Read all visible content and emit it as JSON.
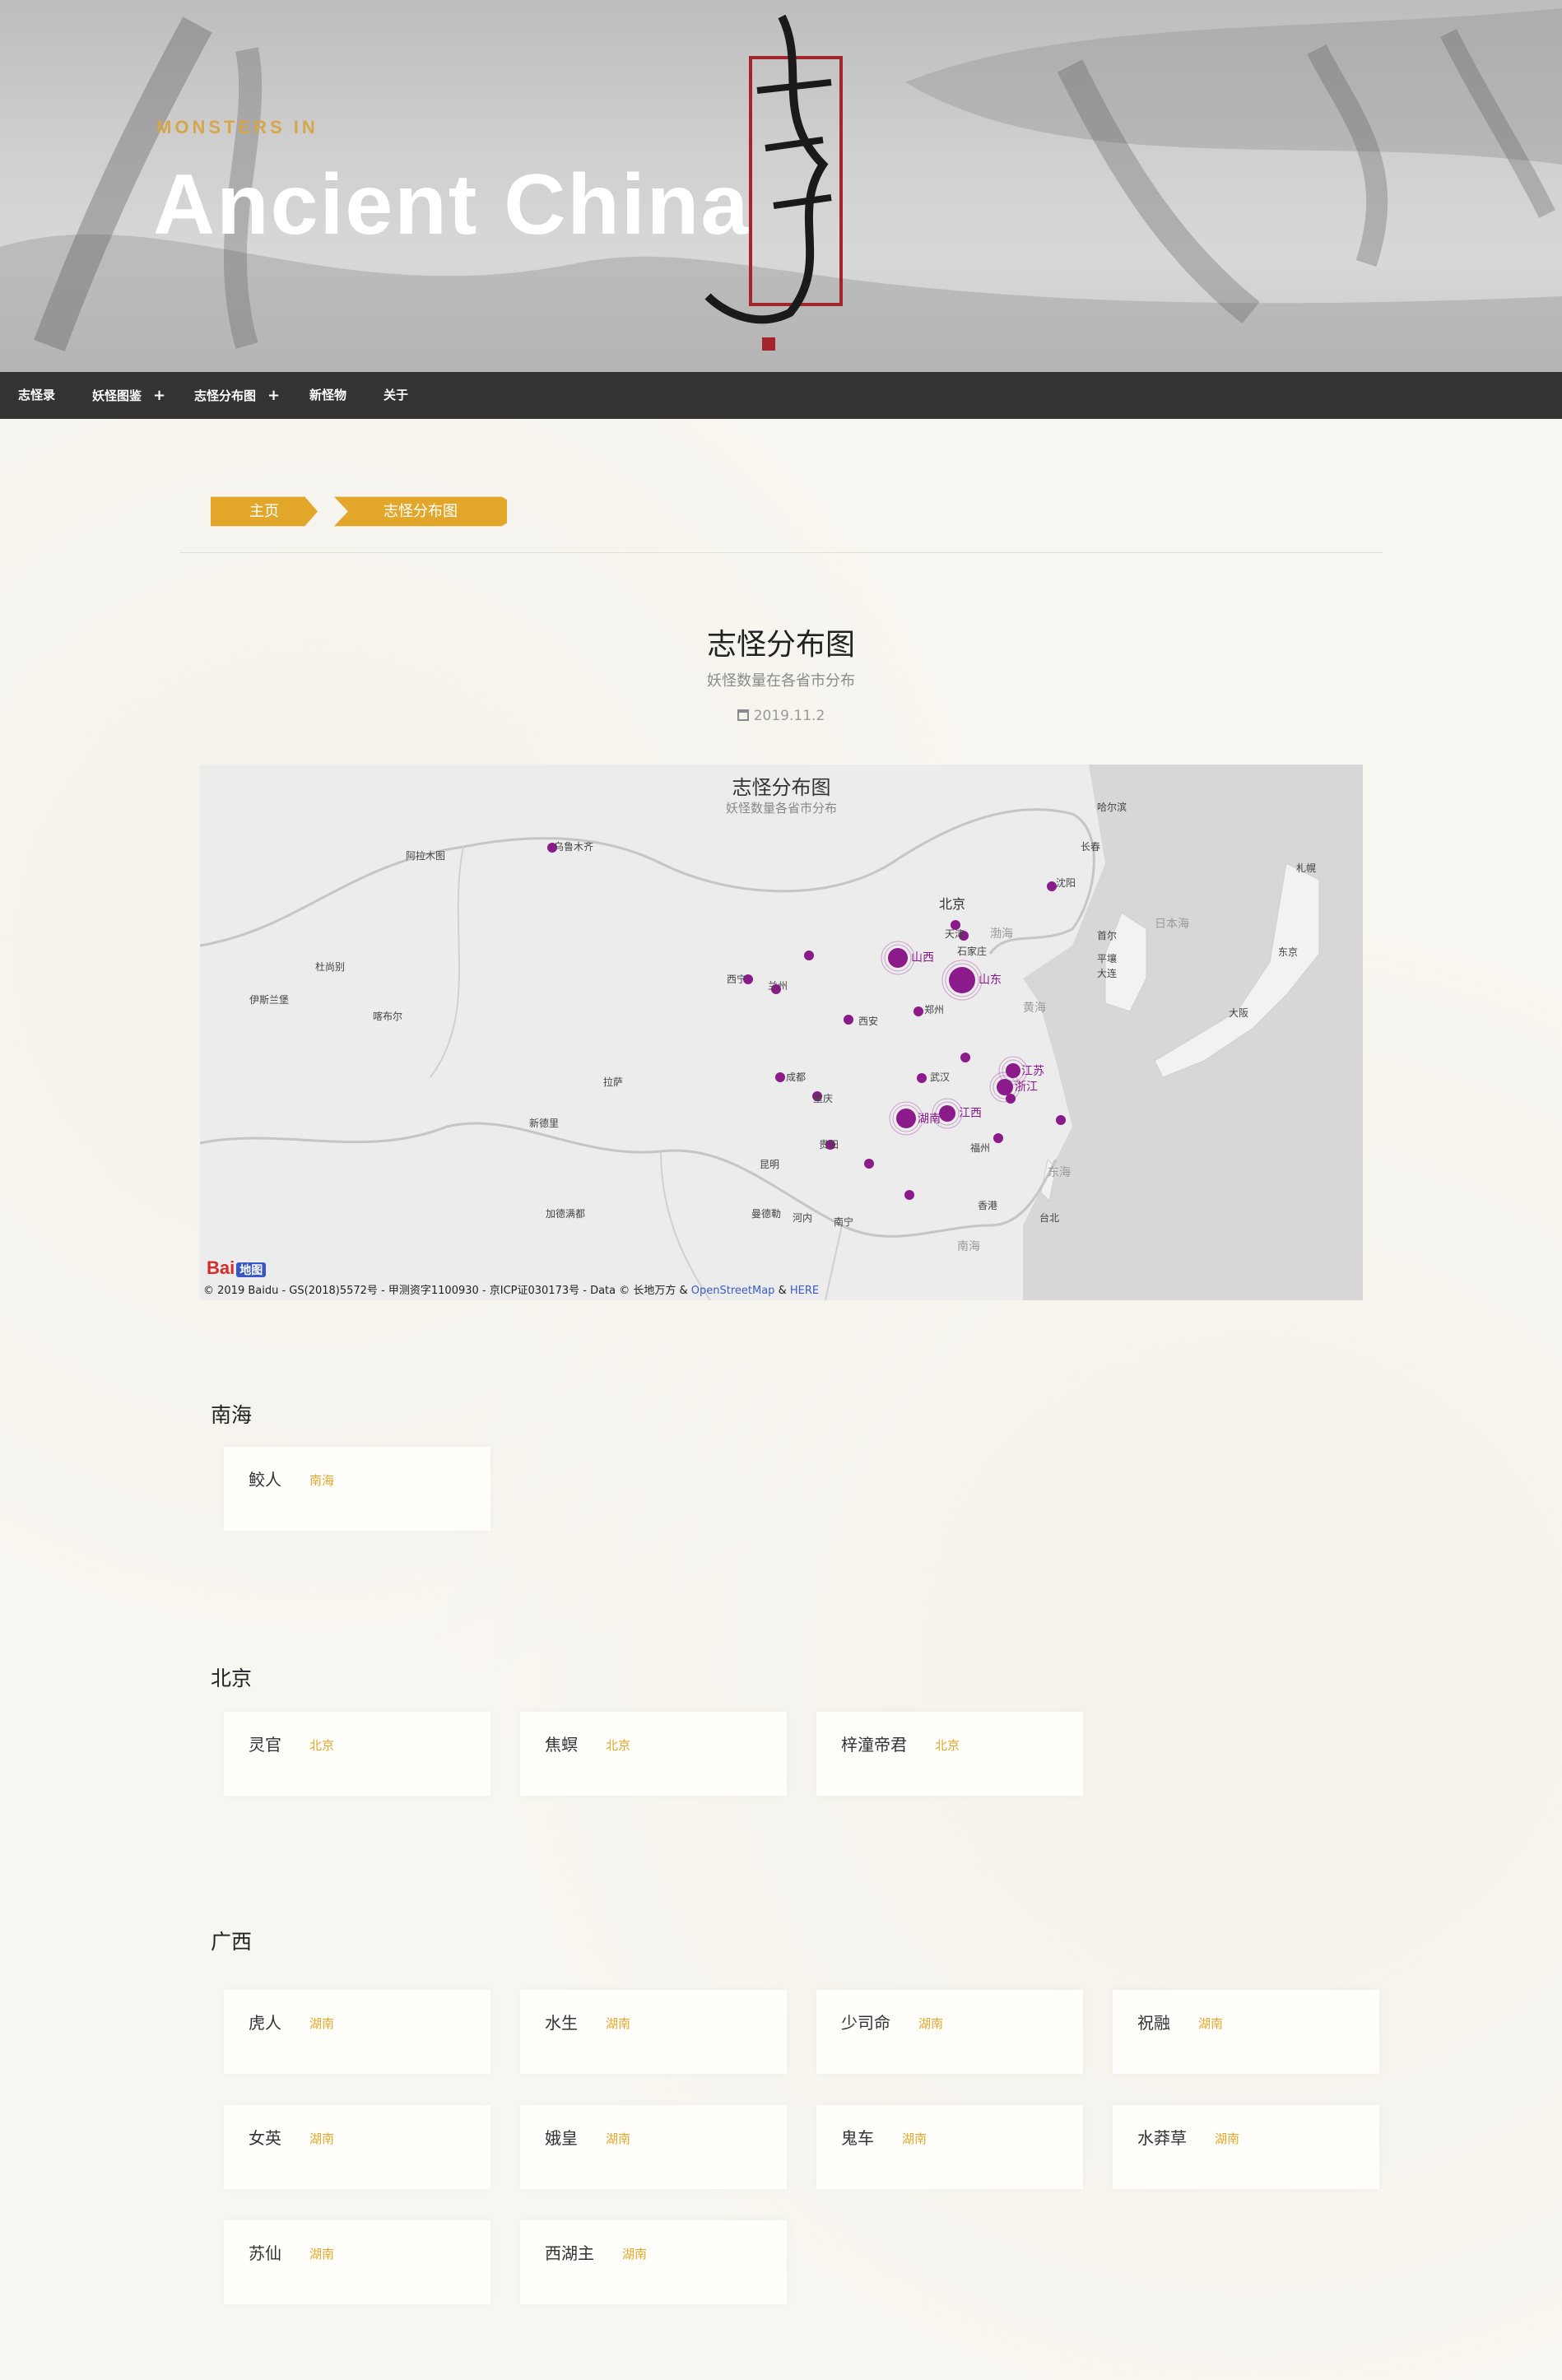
{
  "hero": {
    "subtitle": "MONSTERS IN",
    "title": "Ancient China"
  },
  "nav": [
    {
      "label": "志怪录",
      "dropdown": false
    },
    {
      "label": "妖怪图鉴",
      "dropdown": true
    },
    {
      "label": "志怪分布图",
      "dropdown": true
    },
    {
      "label": "新怪物",
      "dropdown": false
    },
    {
      "label": "关于",
      "dropdown": false
    }
  ],
  "breadcrumb": [
    "主页",
    "志怪分布图"
  ],
  "post": {
    "title": "志怪分布图",
    "subtitle": "妖怪数量在各省市分布",
    "date": "2019.11.2"
  },
  "map": {
    "title": "志怪分布图",
    "subtitle": "妖怪数量各省市分布",
    "credit": "© 2019 Baidu - GS(2018)5572号 - 甲测资字1100930 - 京ICP证030173号 - Data © 长地万方 & ",
    "credit_link1": "OpenStreetMap",
    "credit_amp": " & ",
    "credit_link2": "HERE",
    "baidu_logo": "Bai",
    "baidu_logo2": "地图",
    "highlight_labels": [
      "山西",
      "山东",
      "江苏",
      "浙江",
      "湖南",
      "江西"
    ],
    "city_labels": [
      "北京",
      "天津",
      "石家庄",
      "西宁",
      "兰州",
      "西安",
      "郑州",
      "成都",
      "重庆",
      "武汉",
      "贵阳",
      "南宁",
      "福州",
      "台北",
      "乌鲁木齐",
      "哈尔滨",
      "长春",
      "沈阳",
      "大连",
      "首尔",
      "平壤",
      "大阪",
      "东京",
      "札幌",
      "拉萨",
      "昆明",
      "河内",
      "香港",
      "曼德勒",
      "加德满都",
      "新德里",
      "喀布尔",
      "阿拉木图",
      "杜尚别",
      "伊斯兰堡",
      "日本海",
      "渤海",
      "黄海",
      "东海",
      "南海"
    ]
  },
  "sections": [
    {
      "title": "南海",
      "items": [
        {
          "name": "鲛人",
          "place": "南海"
        }
      ]
    },
    {
      "title": "北京",
      "items": [
        {
          "name": "灵官",
          "place": "北京"
        },
        {
          "name": "焦螟",
          "place": "北京"
        },
        {
          "name": "梓潼帝君",
          "place": "北京"
        }
      ]
    },
    {
      "title": "广西",
      "items": [
        {
          "name": "虎人",
          "place": "湖南"
        },
        {
          "name": "水生",
          "place": "湖南"
        },
        {
          "name": "少司命",
          "place": "湖南"
        },
        {
          "name": "祝融",
          "place": "湖南"
        },
        {
          "name": "女英",
          "place": "湖南"
        },
        {
          "name": "娥皇",
          "place": "湖南"
        },
        {
          "name": "鬼车",
          "place": "湖南"
        },
        {
          "name": "水莽草",
          "place": "湖南"
        },
        {
          "name": "苏仙",
          "place": "湖南"
        },
        {
          "name": "西湖主",
          "place": "湖南"
        }
      ]
    }
  ],
  "colors": {
    "accent": "#e2a72a",
    "nav_bg": "#333333",
    "map_dot": "#8b1a8b"
  }
}
